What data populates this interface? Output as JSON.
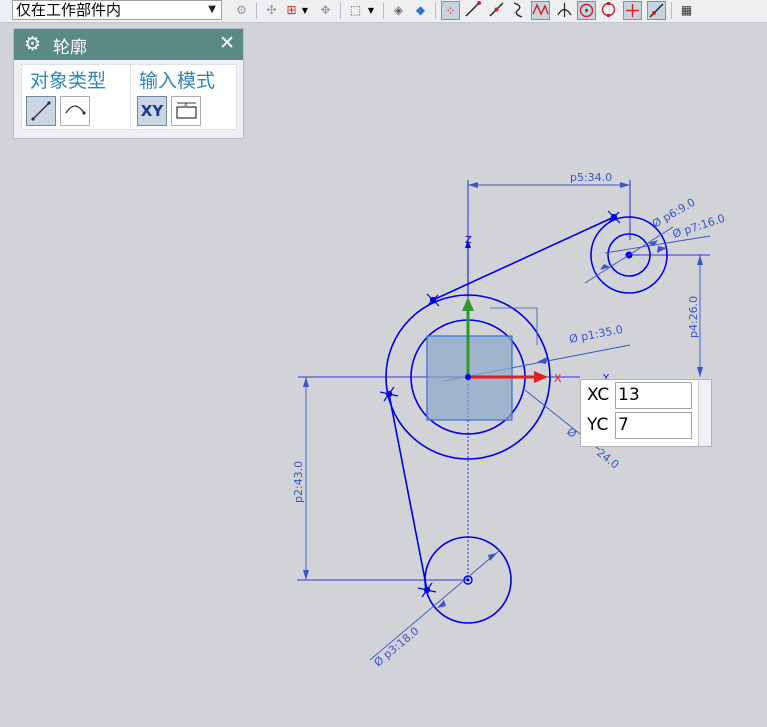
{
  "toolbar": {
    "filter_value": "仅在工作部件内"
  },
  "panel": {
    "title": "轮廓",
    "close_glyph": "✕",
    "object_type_label": "对象类型",
    "input_mode_label": "输入模式",
    "xy_button_label": "XY"
  },
  "coord": {
    "xc_label": "XC",
    "xc_value": "13",
    "yc_label": "YC",
    "yc_value": "7"
  },
  "sketch": {
    "dim_p5": "p5:34.0",
    "dim_p6": "Ø p6:9.0",
    "dim_p7": "Ø p7:16.0",
    "dim_p4": "p4:26.0",
    "dim_p1": "Ø p1:35.0",
    "dim_p2_partial": "Ø",
    "dim_p2_tail": "24.0",
    "dim_p2": "p2:43.0",
    "dim_p3": "Ø p3:18.0",
    "axis_z": "Z",
    "axis_x": "X",
    "axis_y": "Y"
  },
  "colors": {
    "sketch_blue": "#0000e6",
    "dim_blue": "#3b55c8",
    "panel_header": "#5b8a86",
    "label_blue": "#2f86b5",
    "x_axis_red": "#e02020",
    "z_axis_green": "#2a9a2a"
  }
}
